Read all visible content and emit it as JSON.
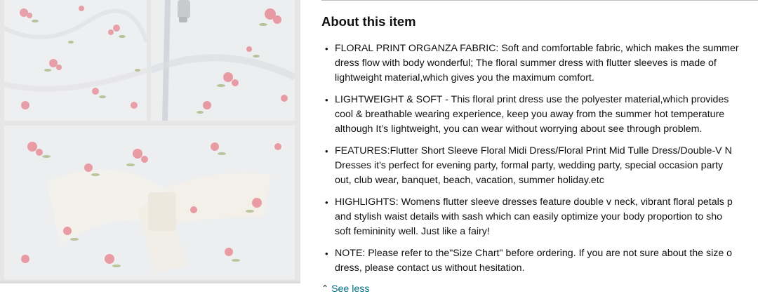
{
  "about": {
    "title": "About this item",
    "bullets": [
      {
        "lines": [
          "FLORAL PRINT ORGANZA FABRIC: Soft and comfortable fabric, which makes the summer",
          "dress flow with body wonderful; The floral summer dress with flutter sleeves is made of",
          "lightweight material,which gives you the maximum comfort."
        ]
      },
      {
        "lines": [
          "LIGHTWEIGHT & SOFT - This floral print dress use the polyester material,which provides",
          "cool & breathable wearing experience, keep you away from the summer hot temperature",
          "although It’s lightweight, you can wear without worrying about see through problem."
        ]
      },
      {
        "lines": [
          "FEATURES:Flutter Short Sleeve Floral Midi Dress/Floral Print Mid Tulle Dress/Double-V N",
          "Dresses it's perfect for evening party, formal party, wedding party, special occasion party",
          "out, club wear, banquet, beach, vacation, summer holiday.etc"
        ]
      },
      {
        "lines": [
          "HIGHLIGHTS: Womens flutter sleeve dresses feature double v neck, vibrant floral petals p",
          "and stylish waist details with sash which can easily optimize your body proportion to sho",
          "soft femininity well. Just like a fairy!"
        ]
      },
      {
        "lines": [
          "NOTE: Please refer to the\"Size Chart\" before ordering. If you are not sure about the size o",
          "dress, please contact us without hesitation."
        ]
      }
    ],
    "see_less": "See less",
    "see_less_icon": "chevron-up-icon"
  },
  "colors": {
    "text": "#0f1111",
    "link": "#007185",
    "rule": "#bbbfbf"
  }
}
